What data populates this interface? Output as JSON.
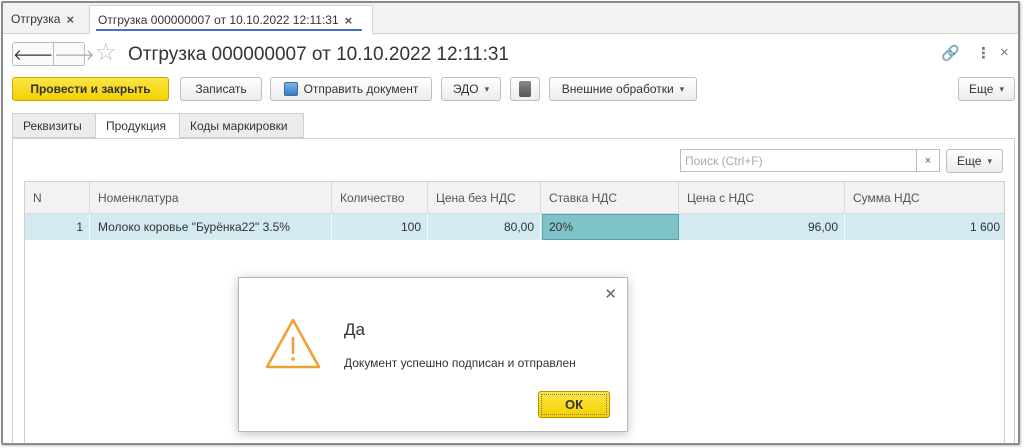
{
  "window_tabs": [
    {
      "label": "Отгрузка"
    },
    {
      "label": "Отгрузка 000000007 от 10.10.2022 12:11:31"
    }
  ],
  "header": {
    "title": "Отгрузка 000000007 от 10.10.2022 12:11:31",
    "back_icon": "arrow-left-icon",
    "forward_icon": "arrow-right-icon",
    "favorite_icon": "star-icon",
    "link_icon": "link-icon",
    "menu_icon": "kebab-icon",
    "close_icon": "close-icon"
  },
  "toolbar": {
    "post_close": "Провести и закрыть",
    "save": "Записать",
    "send_document": "Отправить документ",
    "edo": "ЭДО",
    "external_processing": "Внешние обработки",
    "more": "Еще"
  },
  "form_tabs": [
    {
      "label": "Реквизиты"
    },
    {
      "label": "Продукция"
    },
    {
      "label": "Коды маркировки"
    }
  ],
  "search": {
    "placeholder": "Поиск (Ctrl+F)",
    "clear": "×",
    "more": "Еще"
  },
  "table": {
    "columns": [
      "N",
      "Номенклатура",
      "Количество",
      "Цена без НДС",
      "Ставка НДС",
      "Цена с НДС",
      "Сумма НДС"
    ],
    "rows": [
      [
        "1",
        "Молоко коровье \"Бурёнка22\" 3.5%",
        "100",
        "80,00",
        "20%",
        "96,00",
        "1 600"
      ]
    ]
  },
  "dialog": {
    "title": "Да",
    "message": "Документ успешно подписан и отправлен",
    "ok": "ОК",
    "icon": "warning-triangle-icon"
  },
  "colors": {
    "accent_yellow": "#f5d000",
    "row_highlight": "#d2eaf0",
    "selected_cell": "#7fc3c8",
    "warning_orange": "#f0a030"
  }
}
